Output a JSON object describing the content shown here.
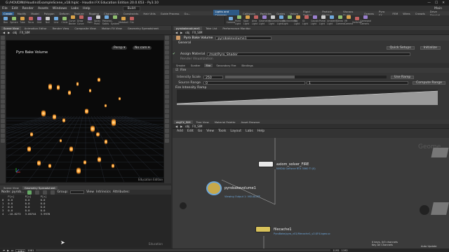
{
  "titlebar": {
    "title": "G:/HOUDINI/Houdini/ExampleScene_v18.hiplc - Houdini FX Education Edition 20.0.653 - Py3.10"
  },
  "menu": {
    "items": [
      "File",
      "Edit",
      "Render",
      "Assets",
      "Windows",
      "Labs",
      "Help"
    ],
    "build": "Build",
    "desktop": "Main"
  },
  "shelf_tabs": [
    "Create",
    "Modify",
    "Model",
    "Polygon",
    "Deform",
    "Texture",
    "Rigging",
    "Characters",
    "Constraints",
    "Hair Utils",
    "Guide Process",
    "Gu..."
  ],
  "right_shelf_tabs": [
    "Lights and Cameras",
    "Collisions",
    "Particles",
    "Grains",
    "Velum",
    "Rigid Bodies",
    "Particle Fluids",
    "Viscous Fluids",
    "Oceans",
    "Pyro FX",
    "FEM",
    "Wires",
    "Crowds",
    "Drive Simulat..."
  ],
  "left_tools": [
    "Box",
    "Sphere",
    "Tube",
    "Torus",
    "Grid",
    "Null",
    "Line",
    "Circle",
    "Curve Bezier",
    "Draw Curve",
    "Path",
    "Spray Paint",
    "Platonic Solids",
    "L-System",
    "Metaball",
    "File"
  ],
  "right_tools": [
    "Camera",
    "Point Light",
    "Spot Light",
    "Area Light",
    "Geometry Light",
    "Volume Light",
    "Distant Light",
    "Environment Light",
    "Sky Light",
    "GI Light",
    "Caustic Light",
    "Portal Light",
    "Ambient Light",
    "Stereo Camera",
    "VR Camera",
    "Switcher",
    "Gamepad Camera"
  ],
  "left_pane": {
    "tabs": [
      "Scene View",
      "Animation Editor",
      "Render View",
      "Composite View",
      "Motion FX View",
      "Geometry Spreadsheet"
    ],
    "path": "obj",
    "network": "FX_SIM",
    "viewport_label": "Pyro Bake Volume",
    "persp": "Persp ▾",
    "cam": "No cam ▾",
    "watermark": "Education Edition"
  },
  "parm_pane": {
    "tabs": [
      "pyrobakevolume1",
      "Take List",
      "Performance Monitor"
    ],
    "path": "obj",
    "network": "FX_SIM",
    "node_type": "Pyro Bake Volume",
    "node_name": "pyrobakevolume1",
    "general": "General",
    "quick_setups": "Quick Setups",
    "initialize": "Initialize",
    "assign_material_label": "Assign Material",
    "assign_material_value": "/mat/Pyro_Shader",
    "render_visualization": "Render Visualization",
    "subtabs": [
      "Smoke",
      "Scatter",
      "Fire",
      "Secondary Fire",
      "Bindings"
    ],
    "fire_section": "Fire",
    "intensity_label": "Intensity Scale",
    "intensity_value": "250",
    "intensity_fill": 0.43,
    "source_label": "Source Range",
    "source_value": "0",
    "source_value2": "1",
    "use_ramp": "Use Ramp",
    "compute_range": "Compute Range",
    "ramp_label": "Fire Intensity Ramp"
  },
  "net_pane": {
    "tabs": [
      "obj/FX_SIM",
      "Tree View",
      "Material Palette",
      "Asset Browser"
    ],
    "path": "obj",
    "network": "FX_SIM",
    "menu": [
      "Add",
      "Edit",
      "Go",
      "View",
      "Tools",
      "Layout",
      "Labs",
      "Help"
    ],
    "context_label": "Geome",
    "nodes": [
      {
        "name": "axiom_solver_FIRE",
        "sub": "NVIDIA GeForce RTX 3060 Ti (0)"
      },
      {
        "name": "pyrobakevolume1",
        "sub": "Viewing Output 1: VISUALIZE"
      },
      {
        "name": "filecache1",
        "sub": "PyroBake/pyro_v01/filecache1_v2.$F4.bgeo.sc"
      }
    ]
  },
  "spreadsheet": {
    "tabs": [
      "Scene View",
      "Geometry Spreadsheet"
    ],
    "node": "Node: pyrob...",
    "group": "Group:",
    "view": "View",
    "intrinsics": "Intrinsics",
    "attributes": "Attributes:",
    "columns": [
      "",
      "P[x]",
      "P[y]",
      "P[z]"
    ],
    "rows": [
      [
        "0",
        "0.0",
        "0.0",
        "0.0"
      ],
      [
        "1",
        "0.0",
        "0.0",
        "0.0"
      ],
      [
        "2",
        "0.0",
        "0.0",
        "0.0"
      ],
      [
        "3",
        "0.0",
        "0.0",
        "0.0"
      ],
      [
        "4",
        "-10.8273",
        "3.00744",
        "3.9978"
      ]
    ],
    "education": "Education"
  },
  "timeline": {
    "frame": "1061",
    "start": "1061",
    "end": "1192",
    "end2": "1192",
    "marks": [
      "1061",
      "1192"
    ],
    "keys": "0 keys, 0/0 channels",
    "key_all": "Key All Channels",
    "auto_update": "Auto Update"
  },
  "colors": {
    "accent": "#2e5a86",
    "fire": "#ff9a2a",
    "background": "#2b2b2b"
  }
}
